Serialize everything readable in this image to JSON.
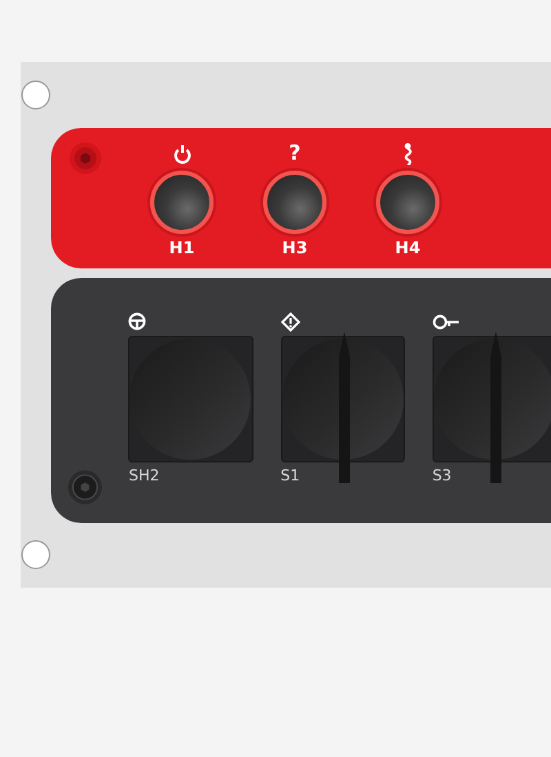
{
  "panel": {
    "buttons": [
      {
        "kind": "icon",
        "label": "H1"
      },
      {
        "kind": "text",
        "symbol": "?",
        "label": "H3"
      },
      {
        "kind": "icon",
        "label": "H4"
      }
    ],
    "switches": [
      {
        "kind": "plain",
        "label": "SH2"
      },
      {
        "kind": "lever",
        "label": "S1"
      },
      {
        "kind": "lever",
        "label": "S3"
      }
    ]
  }
}
